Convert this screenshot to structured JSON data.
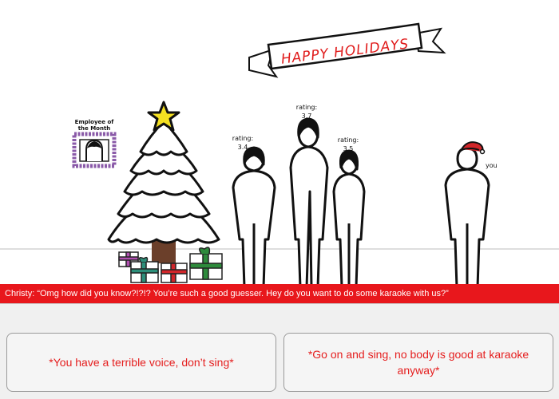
{
  "banner": {
    "text": "HAPPY HOLIDAYS"
  },
  "frame": {
    "caption": "Employee of the Month"
  },
  "characters": [
    {
      "id": "left",
      "rating_label": "rating:",
      "rating_value": "3.4"
    },
    {
      "id": "tall",
      "rating_label": "rating:",
      "rating_value": "3.7"
    },
    {
      "id": "right",
      "rating_label": "rating:",
      "rating_value": "3.5"
    }
  ],
  "player": {
    "label": "you"
  },
  "dialogue": {
    "text": "Christy: “Omg how did you know?!?!? You’re such a good guesser. Hey do you want to do some karaoke with us?”"
  },
  "choices": [
    {
      "text": "*You have a terrible voice, don’t sing*"
    },
    {
      "text": "*Go on and sing, no body is good at karaoke anyway*"
    }
  ],
  "colors": {
    "accent": "#e8171c",
    "frame": "#8a5aa8",
    "star": "#f4e021",
    "tree_trunk": "#6b3f2a"
  }
}
